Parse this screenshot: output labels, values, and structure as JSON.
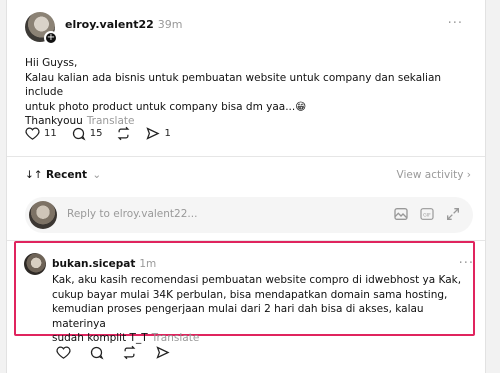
{
  "post": {
    "username": "elroy.valent22",
    "time": "39m",
    "more": "···",
    "lines": [
      "Hii Guyss,",
      "Kalau kalian ada bisnis untuk pembuatan website untuk company dan sekalian include",
      "untuk photo product untuk company bisa dm yaa...😁",
      "Thankyouu"
    ],
    "translate": "Translate",
    "likes": "11",
    "comments": "15",
    "shares": "1"
  },
  "thread": {
    "sort_label": "Recent",
    "sort_icon": "↓↑",
    "view_activity": "View activity ›"
  },
  "reply": {
    "placeholder": "Reply to elroy.valent22..."
  },
  "comment": {
    "username": "bukan.sicepat",
    "time": "1m",
    "more": "···",
    "lines": [
      "Kak, aku kasih recomendasi pembuatan website compro di idwebhost ya Kak,",
      "cukup bayar mulai 34K perbulan, bisa mendapatkan domain sama hosting,",
      "kemudian proses pengerjaan mulai dari 2 hari dah bisa di akses, kalau materinya",
      "sudah komplit T_T"
    ],
    "translate": "Translate",
    "highlight_color": "#e0245e"
  }
}
